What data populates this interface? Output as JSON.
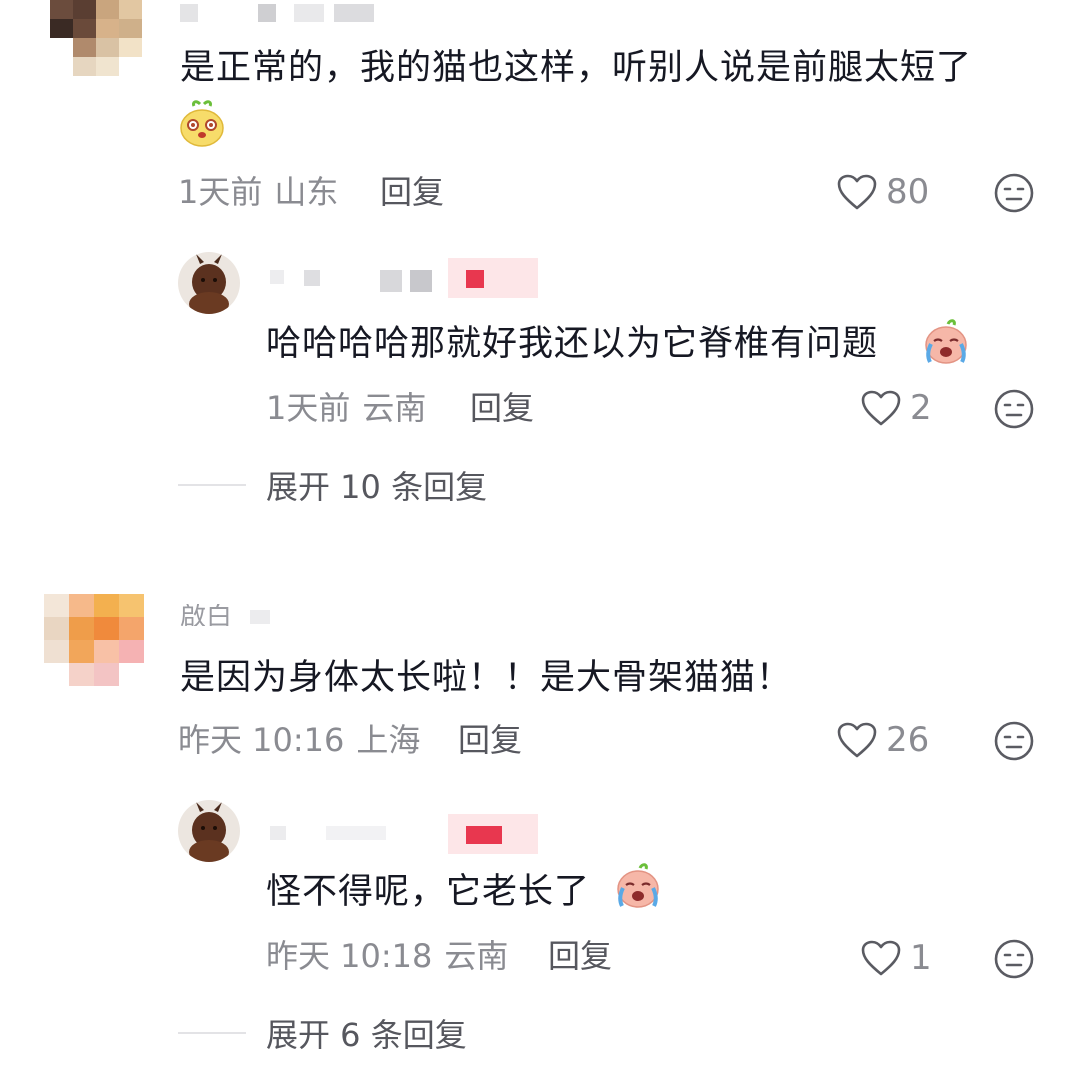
{
  "comments": [
    {
      "text": "是正常的，我的猫也这样，听别人说是前腿太短了",
      "emoji": "yellow-blob-emoji",
      "time": "1天前",
      "location": "山东",
      "reply_label": "回复",
      "likes": "80",
      "replies": [
        {
          "text": "哈哈哈哈那就好我还以为它脊椎有问题",
          "emoji": "crying-emoji",
          "time": "1天前",
          "location": "云南",
          "reply_label": "回复",
          "likes": "2"
        }
      ],
      "expand_label": "展开 10 条回复"
    },
    {
      "name_partial": "啟白",
      "text": "是因为身体太长啦！！是大骨架猫猫！",
      "time": "昨天 10:16",
      "location": "上海",
      "reply_label": "回复",
      "likes": "26",
      "replies": [
        {
          "text": "怪不得呢，它老长了",
          "emoji": "crying-emoji",
          "time": "昨天 10:18",
          "location": "云南",
          "reply_label": "回复",
          "likes": "1"
        }
      ],
      "expand_label": "展开 6 条回复"
    }
  ],
  "colors": {
    "heart": "#5a5b62",
    "meta": "#8a8b91",
    "text": "#161823",
    "author_badge": "#e8374f"
  },
  "icons": {
    "like": "heart-outline-icon",
    "dislike": "meh-face-icon"
  }
}
